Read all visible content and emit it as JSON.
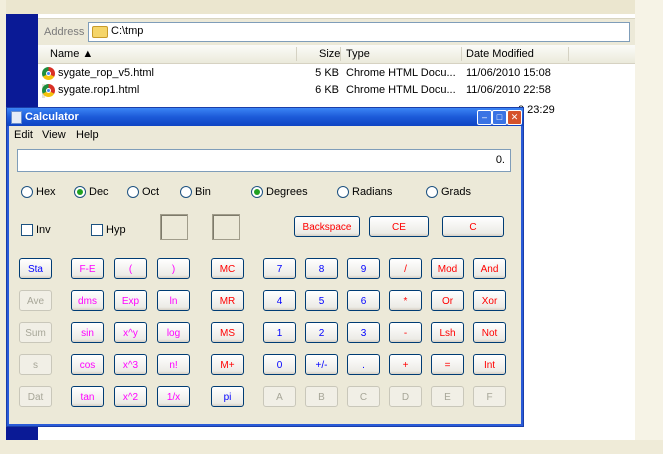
{
  "explorer": {
    "address_label": "Address",
    "address_value": "C:\\tmp",
    "columns": {
      "name": "Name ▲",
      "size": "Size",
      "type": "Type",
      "date": "Date Modified"
    },
    "files": [
      {
        "name": "sygate_rop_v5.html",
        "size": "5 KB",
        "type": "Chrome HTML Docu...",
        "date": "11/06/2010 15:08"
      },
      {
        "name": "sygate.rop1.html",
        "size": "6 KB",
        "type": "Chrome HTML Docu...",
        "date": "11/06/2010 22:58"
      }
    ],
    "partial_date": "0 23:29"
  },
  "calculator": {
    "title": "Calculator",
    "menu": [
      "Edit",
      "View",
      "Help"
    ],
    "display": "0.",
    "base_options": [
      "Hex",
      "Dec",
      "Oct",
      "Bin"
    ],
    "base_selected": "Dec",
    "angle_options": [
      "Degrees",
      "Radians",
      "Grads"
    ],
    "angle_selected": "Degrees",
    "checkboxes": [
      "Inv",
      "Hyp"
    ],
    "edit_buttons": [
      "Backspace",
      "CE",
      "C"
    ],
    "stat_buttons": [
      "Sta",
      "Ave",
      "Sum",
      "s",
      "Dat"
    ],
    "sci_buttons": [
      [
        "F-E",
        "(",
        ")"
      ],
      [
        "dms",
        "Exp",
        "ln"
      ],
      [
        "sin",
        "x^y",
        "log"
      ],
      [
        "cos",
        "x^3",
        "n!"
      ],
      [
        "tan",
        "x^2",
        "1/x"
      ]
    ],
    "memory_buttons": [
      "MC",
      "MR",
      "MS",
      "M+",
      "pi"
    ],
    "digit_rows": [
      [
        "7",
        "8",
        "9",
        "/",
        "Mod",
        "And"
      ],
      [
        "4",
        "5",
        "6",
        "*",
        "Or",
        "Xor"
      ],
      [
        "1",
        "2",
        "3",
        "-",
        "Lsh",
        "Not"
      ],
      [
        "0",
        "+/-",
        ".",
        "+",
        "=",
        "Int"
      ],
      [
        "A",
        "B",
        "C",
        "D",
        "E",
        "F"
      ]
    ],
    "colors": {
      "blue": "#0000ff",
      "red": "#ff0000",
      "magenta": "#ff00ff"
    }
  }
}
